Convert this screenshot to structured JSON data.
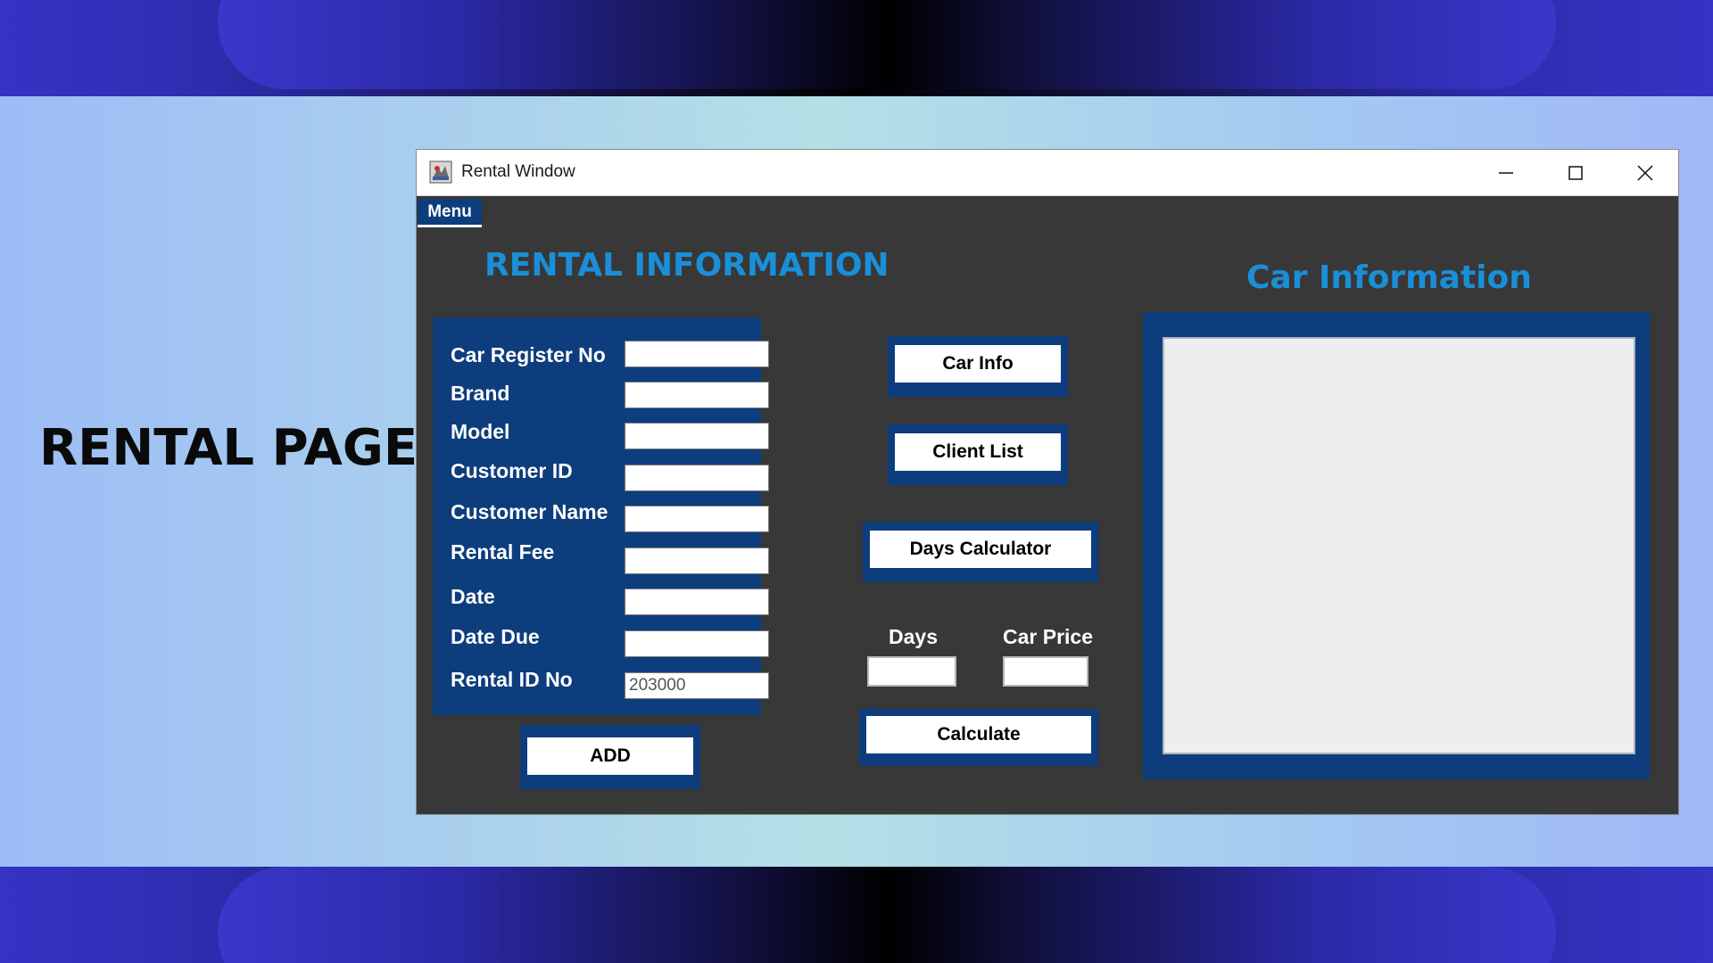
{
  "slide": {
    "heading": "RENTAL PAGE"
  },
  "window": {
    "title": "Rental Window"
  },
  "menu": {
    "label": "Menu"
  },
  "rental_section": {
    "title": "RENTAL INFORMATION",
    "fields": [
      {
        "label": "Car Register No",
        "value": ""
      },
      {
        "label": "Brand",
        "value": ""
      },
      {
        "label": "Model",
        "value": ""
      },
      {
        "label": "Customer ID",
        "value": ""
      },
      {
        "label": "Customer Name",
        "value": ""
      },
      {
        "label": "Rental Fee",
        "value": ""
      },
      {
        "label": "Date",
        "value": ""
      },
      {
        "label": "Date Due",
        "value": ""
      },
      {
        "label": "Rental ID No",
        "value": "203000"
      }
    ],
    "add_label": "ADD"
  },
  "actions": {
    "car_info_label": "Car Info",
    "client_list_label": "Client List",
    "days_calculator_label": "Days Calculator",
    "days_label": "Days",
    "car_price_label": "Car Price",
    "days_value": "",
    "car_price_value": "",
    "calculate_label": "Calculate"
  },
  "car_section": {
    "title": "Car Information",
    "content": ""
  },
  "colors": {
    "panel": "#0d3d7c",
    "heading": "#1a8fd8",
    "window_bg": "#383838"
  }
}
